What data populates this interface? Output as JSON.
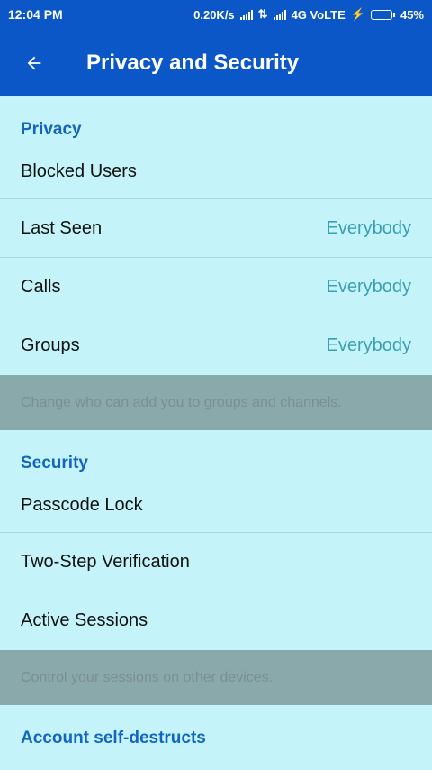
{
  "status_bar": {
    "time": "12:04 PM",
    "network_speed": "0.20K/s",
    "network": "4G VoLTE",
    "battery": "45%",
    "battery_level": 0.45
  },
  "app_bar": {
    "back_icon": "arrow-left-icon",
    "title": "Privacy and Security"
  },
  "privacy": {
    "header": "Privacy",
    "blocked_users": "Blocked Users",
    "last_seen": {
      "label": "Last Seen",
      "value": "Everybody"
    },
    "calls": {
      "label": "Calls",
      "value": "Everybody"
    },
    "groups": {
      "label": "Groups",
      "value": "Everybody"
    },
    "hint": "Change who can add you to groups and channels."
  },
  "security": {
    "header": "Security",
    "passcode_lock": "Passcode Lock",
    "two_step": "Two-Step Verification",
    "active_sessions": "Active Sessions",
    "hint": "Control your sessions on other devices."
  },
  "account": {
    "header": "Account self-destructs"
  },
  "colors": {
    "primary": "#0b57c7",
    "background": "#c4f4f9",
    "section_header": "#1565c0",
    "value_text": "#3b9fb3",
    "hint_bg": "#8aa9ab"
  }
}
